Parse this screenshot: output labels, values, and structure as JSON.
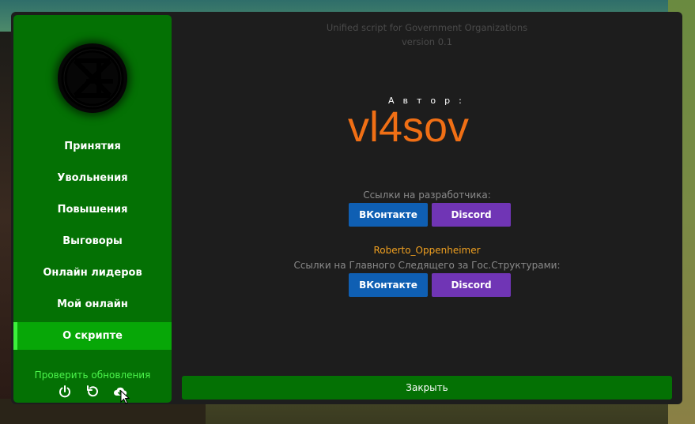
{
  "sidebar": {
    "items": [
      {
        "label": "Принятия"
      },
      {
        "label": "Увольнения"
      },
      {
        "label": "Повышения"
      },
      {
        "label": "Выговоры"
      },
      {
        "label": "Онлайн лидеров"
      },
      {
        "label": "Мой онлайн"
      },
      {
        "label": "О скрипте"
      }
    ],
    "active_index": 6,
    "update_label": "Проверить обновления",
    "icons": [
      "power-icon",
      "reload-icon",
      "cloud-download-icon"
    ]
  },
  "header": {
    "title": "Unified script for Government Organizations",
    "version": "version 0.1"
  },
  "author": {
    "label": "Автор:",
    "name": "vl4sov"
  },
  "developer_links": {
    "label": "Ссылки на разработчика:",
    "vk_label": "ВКонтакте",
    "discord_label": "Discord"
  },
  "supervisor": {
    "name": "Roberto_Oppenheimer",
    "label": "Ссылки на Главного Следящего за Гос.Структурами:",
    "vk_label": "ВКонтакте",
    "discord_label": "Discord"
  },
  "close_label": "Закрыть",
  "colors": {
    "sidebar_bg": "#047104",
    "active_item_bg": "#07a707",
    "accent_orange": "#f06f15",
    "supervisor_name": "#f0a020",
    "vk": "#0f5fb3",
    "discord": "#7035b5"
  }
}
